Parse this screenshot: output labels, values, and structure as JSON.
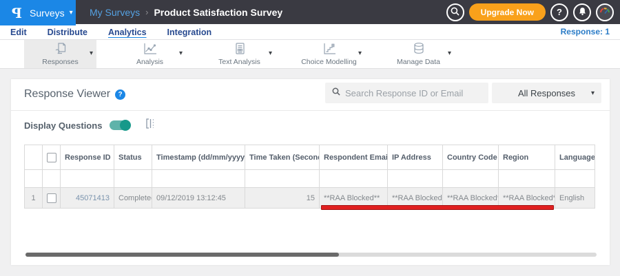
{
  "topbar": {
    "logo_text": "P",
    "menu_label": "Surveys",
    "breadcrumb_parent": "My Surveys",
    "breadcrumb_sep": "›",
    "breadcrumb_current": "Product Satisfaction Survey",
    "upgrade_label": "Upgrade Now"
  },
  "nav": {
    "tabs": [
      {
        "label": "Edit"
      },
      {
        "label": "Distribute"
      },
      {
        "label": "Analytics",
        "active": true
      },
      {
        "label": "Integration"
      }
    ],
    "response_count": "Response: 1"
  },
  "toolbar": {
    "items": [
      {
        "label": "Responses",
        "selected": true
      },
      {
        "label": "Analysis"
      },
      {
        "label": "Text Analysis"
      },
      {
        "label": "Choice Modelling"
      },
      {
        "label": "Manage Data"
      }
    ]
  },
  "panel": {
    "title": "Response Viewer",
    "search_placeholder": "Search Response ID or Email",
    "responses_filter": "All Responses",
    "display_questions": "Display Questions",
    "display_questions_on": true
  },
  "table": {
    "columns": [
      {
        "label": "Response ID",
        "sort": "desc"
      },
      {
        "label": "Status"
      },
      {
        "label": "Timestamp (dd/mm/yyyy)",
        "sort": "both"
      },
      {
        "label": "Time Taken (Seconds)",
        "sort": "both"
      },
      {
        "label": "Respondent Email"
      },
      {
        "label": "IP Address"
      },
      {
        "label": "Country Code"
      },
      {
        "label": "Region"
      },
      {
        "label": "Language"
      }
    ],
    "rows": [
      {
        "num": "1",
        "response_id": "45071413",
        "status": "Completed",
        "timestamp": "09/12/2019 13:12:45",
        "time_taken": "15",
        "respondent_email": "**RAA Blocked**",
        "ip_address": "**RAA Blocked**",
        "country_code": "**RAA Blocked**",
        "region": "**RAA Blocked**",
        "language": "English"
      }
    ]
  },
  "icons": {
    "caret_down": "▾",
    "sort_desc": "▼",
    "sort_both": "⇅",
    "question_mark": "?"
  },
  "colors": {
    "accent_blue": "#1B87E6",
    "topbar_bg": "#3A3A42",
    "upgrade_orange": "#F9A11B",
    "toggle_teal": "#17998A",
    "nav_navy": "#27498F",
    "annotation_red": "#E02020",
    "row_gray": "#EFEFEF"
  }
}
